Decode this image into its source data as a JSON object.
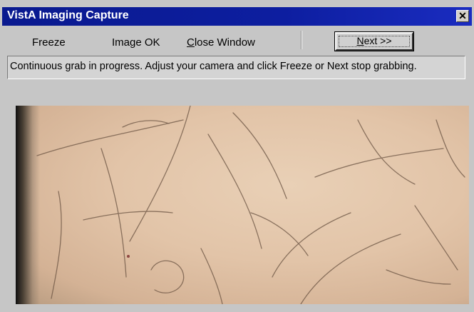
{
  "window": {
    "title": "VistA Imaging Capture",
    "close_symbol": "✕"
  },
  "menu": {
    "freeze": "Freeze",
    "image_ok": "Image OK",
    "close_window": "Close Window",
    "next": "Next >>"
  },
  "status": {
    "message": "Continuous grab in progress.  Adjust your camera and click Freeze or Next stop grabbing."
  },
  "colors": {
    "titlebar": "#0a1a8f",
    "window_bg": "#c6c6c6"
  }
}
